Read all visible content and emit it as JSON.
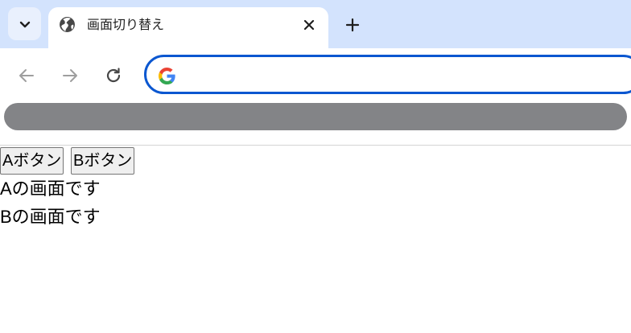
{
  "browser": {
    "tab": {
      "title": "画面切り替え"
    },
    "omnibox": {
      "value": "",
      "placeholder": ""
    },
    "colors": {
      "tabstrip": "#d3e3fd",
      "accent": "#0b57d0"
    }
  },
  "page": {
    "buttons": [
      {
        "label": "Aボタン"
      },
      {
        "label": "Bボタン"
      }
    ],
    "screens": [
      {
        "text": "Aの画面です"
      },
      {
        "text": "Bの画面です"
      }
    ]
  }
}
